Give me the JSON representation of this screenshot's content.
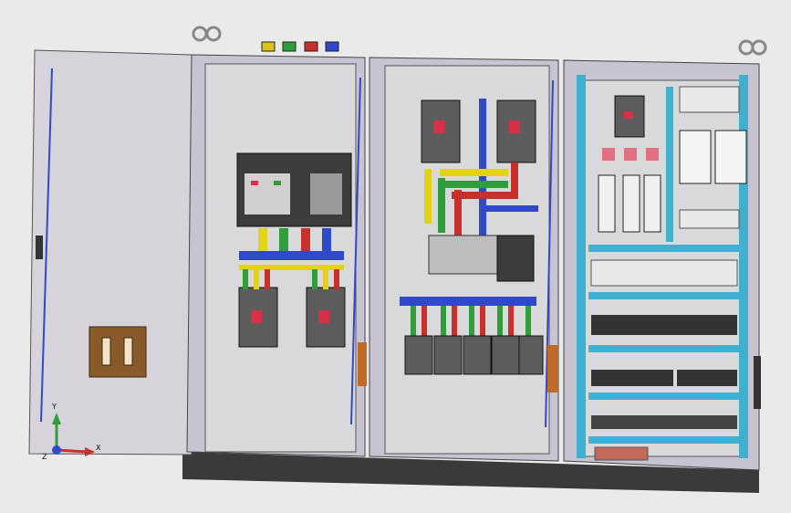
{
  "viewport": {
    "axis_labels": {
      "x": "X",
      "y": "Y",
      "z": "Z"
    }
  },
  "colors": {
    "background": "#eaeaea",
    "panel": "#d9d9dc",
    "cabinet_frame": "#c8c3d0",
    "base_plinth": "#3a3a3a",
    "busbar_blue": "#2f49c9",
    "busbar_yellow": "#e2d21a",
    "busbar_green": "#2f9e3a",
    "busbar_red": "#c8302c",
    "din_rail_cyan": "#3fb0cf",
    "breaker_gray": "#5c5c5c",
    "handle_red": "#d9304a",
    "door_lock_brown": "#8a5a2a"
  },
  "components": {
    "left_door": {
      "icon": "hinged-door"
    },
    "terminal_caps": [
      {
        "color": "#d9c21a"
      },
      {
        "color": "#2f9e3a"
      },
      {
        "color": "#c8302c"
      },
      {
        "color": "#2f49c9"
      }
    ],
    "lifting_eyes": [
      "lifting-eye-icon",
      "lifting-eye-icon"
    ]
  }
}
